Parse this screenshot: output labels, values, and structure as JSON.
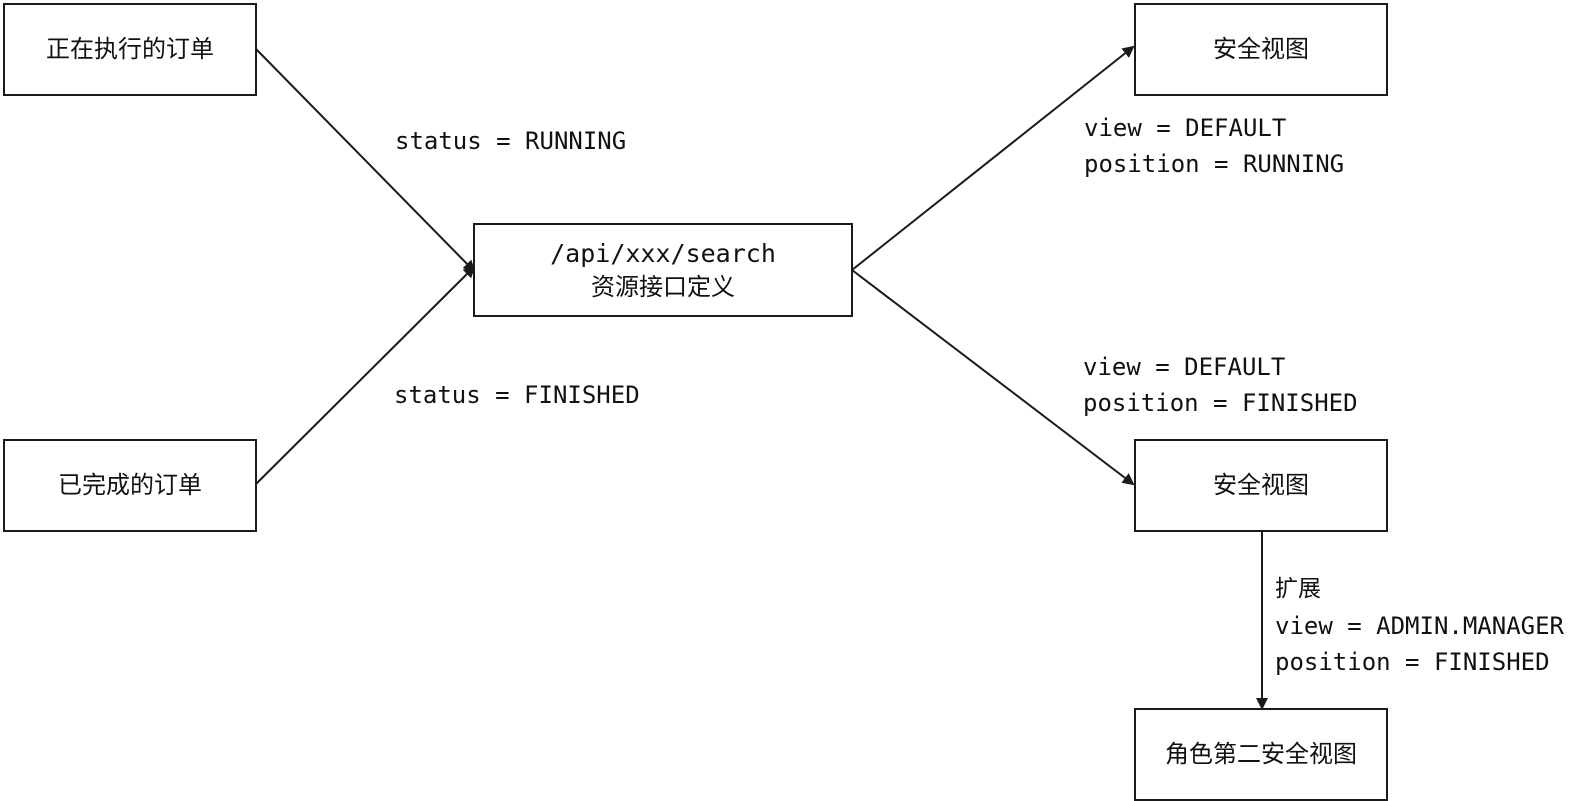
{
  "nodes": {
    "running_orders": "正在执行的订单",
    "finished_orders": "已完成的订单",
    "api_endpoint": "/api/xxx/search",
    "api_description": "资源接口定义",
    "security_view_top": "安全视图",
    "security_view_bottom": "安全视图",
    "role_security_view": "角色第二安全视图"
  },
  "edge_labels": {
    "status_running": "status = RUNNING",
    "status_finished": "status = FINISHED",
    "top_view": "view = DEFAULT",
    "top_position": "position = RUNNING",
    "bottom_view": "view = DEFAULT",
    "bottom_position": "position = FINISHED",
    "extend_title": "扩展",
    "extend_view": "view = ADMIN.MANAGER",
    "extend_position": "position = FINISHED"
  },
  "colors": {
    "line": "#1a1a1a",
    "border": "#1a1a1a",
    "background": "#ffffff"
  }
}
